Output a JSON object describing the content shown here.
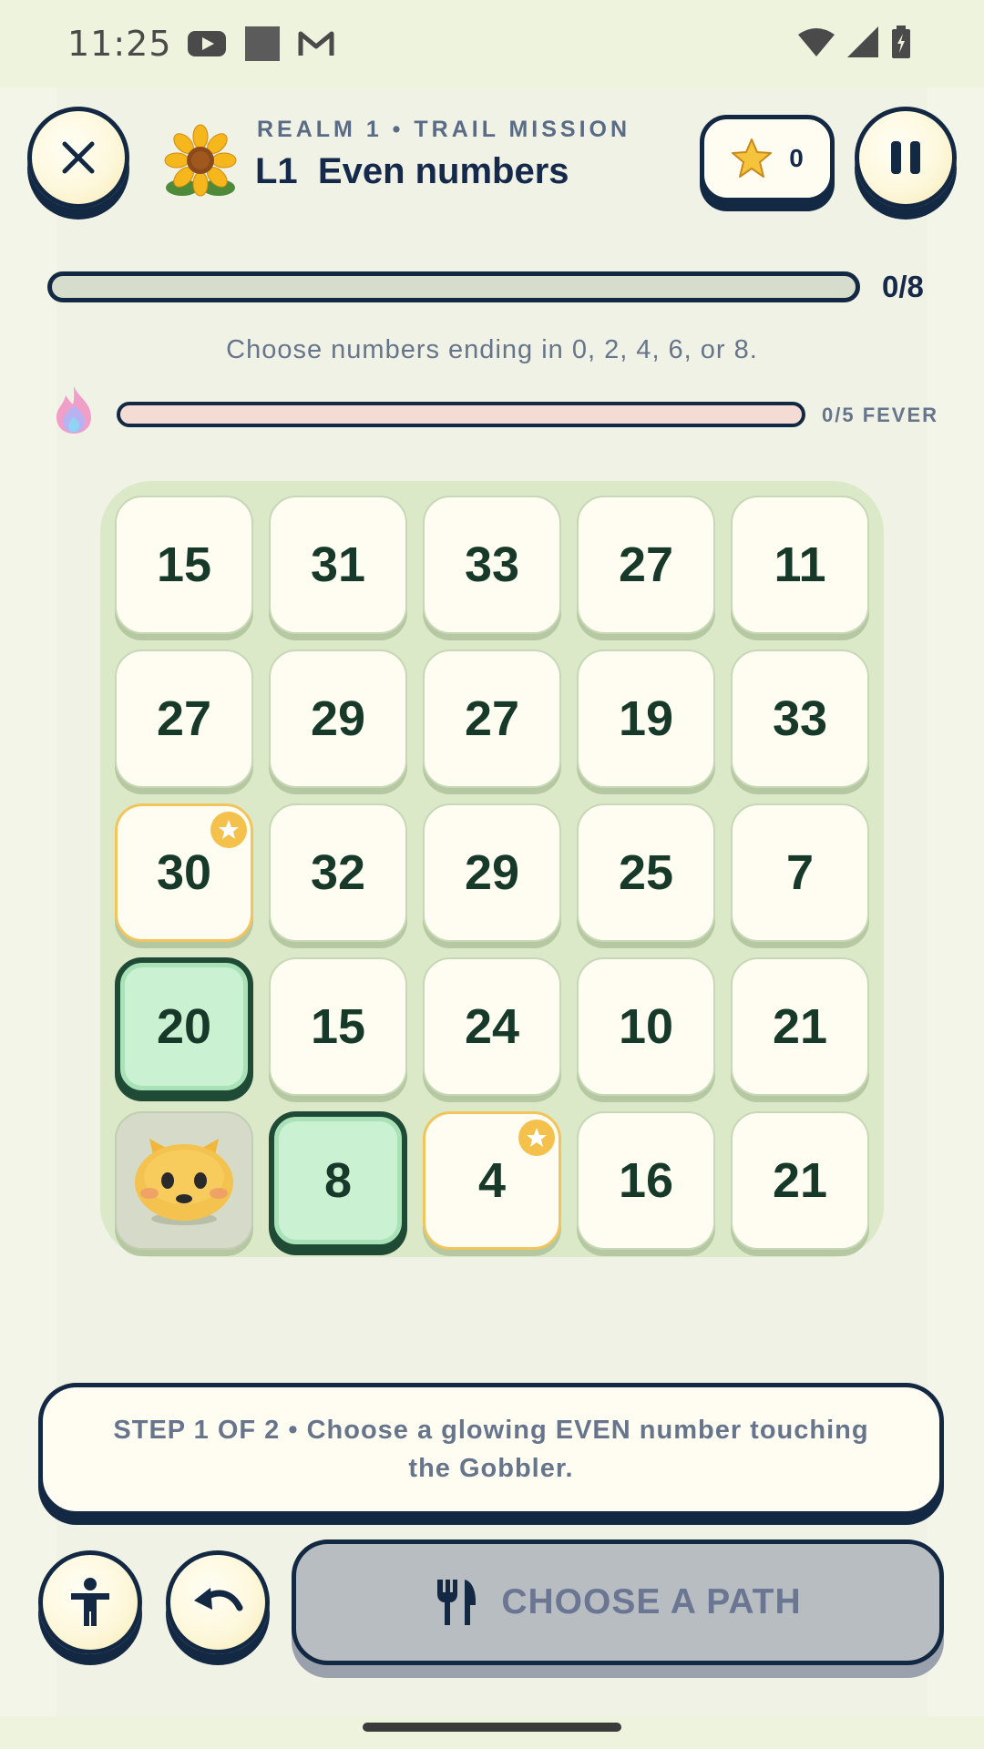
{
  "status_bar": {
    "time": "11:25",
    "icons": [
      "youtube-icon",
      "square-icon",
      "gmail-icon",
      "wifi-icon",
      "signal-icon",
      "battery-icon"
    ]
  },
  "header": {
    "realm_label": "REALM 1 • TRAIL MISSION",
    "level_title": "L1  Even numbers",
    "level_icon": "sunflower-icon",
    "star_count": "0"
  },
  "progress": {
    "text": "0/8",
    "value": 0
  },
  "hint": "Choose numbers ending in 0, 2, 4, 6, or 8.",
  "fever": {
    "text": "0/5 FEVER",
    "value": 0
  },
  "board": {
    "rows": [
      [
        {
          "value": "15"
        },
        {
          "value": "31"
        },
        {
          "value": "33"
        },
        {
          "value": "27"
        },
        {
          "value": "11"
        }
      ],
      [
        {
          "value": "27"
        },
        {
          "value": "29"
        },
        {
          "value": "27"
        },
        {
          "value": "19"
        },
        {
          "value": "33"
        }
      ],
      [
        {
          "value": "30",
          "star": true
        },
        {
          "value": "32"
        },
        {
          "value": "29"
        },
        {
          "value": "25"
        },
        {
          "value": "7"
        }
      ],
      [
        {
          "value": "20",
          "state": "path"
        },
        {
          "value": "15"
        },
        {
          "value": "24"
        },
        {
          "value": "10"
        },
        {
          "value": "21"
        }
      ],
      [
        {
          "gobbler": true
        },
        {
          "value": "8",
          "state": "path"
        },
        {
          "value": "4",
          "star": true
        },
        {
          "value": "16"
        },
        {
          "value": "21"
        }
      ]
    ]
  },
  "instruction": "STEP 1 OF 2 • Choose a glowing EVEN number touching the Gobbler.",
  "action": {
    "label": "CHOOSE A PATH",
    "icon": "fork-knife-icon"
  },
  "colors": {
    "ink": "#132842",
    "tile": "#fffdf1",
    "path_tile": "#c9f1d2",
    "star": "#f4c14d",
    "board": "#dbe9c8"
  }
}
